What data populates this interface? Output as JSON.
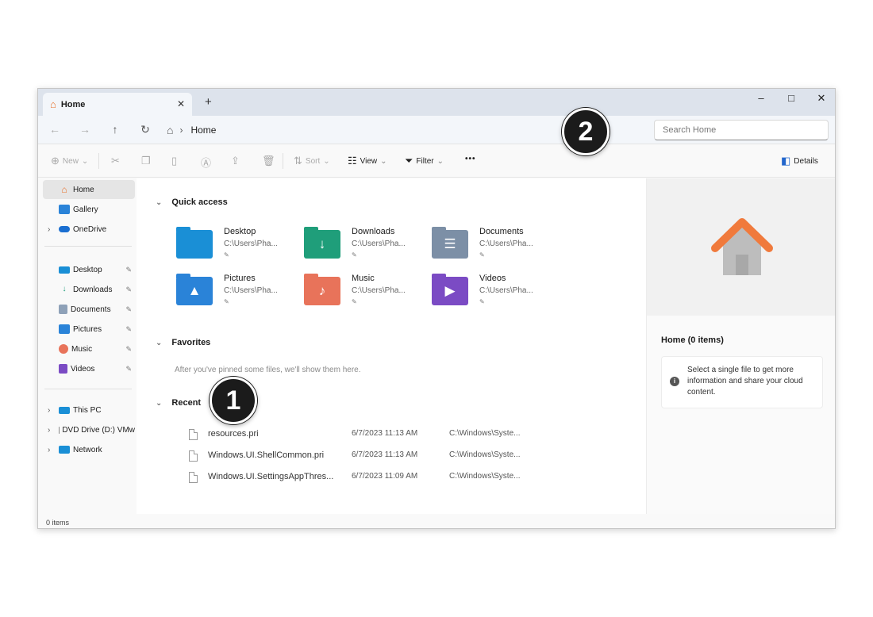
{
  "window": {
    "tab_title": "Home",
    "tab_close": "✕",
    "new_tab": "+",
    "minimize": "–",
    "maximize": "□",
    "close": "✕"
  },
  "nav": {
    "back": "←",
    "forward": "→",
    "up": "↑",
    "refresh": "↻",
    "breadcrumb": "Home",
    "search_placeholder": "Search Home"
  },
  "toolbar": {
    "new_label": "New",
    "sort_label": "Sort",
    "view_label": "View",
    "filter_label": "Filter",
    "more_label": "•••",
    "details_label": "Details"
  },
  "sidebar": {
    "items": [
      {
        "label": "Home",
        "icon": "home-icon"
      },
      {
        "label": "Gallery",
        "icon": "gallery-icon"
      },
      {
        "label": "OneDrive",
        "icon": "onedrive-icon"
      },
      {
        "label": "Desktop",
        "icon": "desktop-icon"
      },
      {
        "label": "Downloads",
        "icon": "downloads-icon"
      },
      {
        "label": "Documents",
        "icon": "documents-icon"
      },
      {
        "label": "Pictures",
        "icon": "pictures-icon"
      },
      {
        "label": "Music",
        "icon": "music-icon"
      },
      {
        "label": "Videos",
        "icon": "videos-icon"
      },
      {
        "label": "This PC",
        "icon": "computer-icon"
      },
      {
        "label": "DVD Drive (D:) VMw",
        "icon": "dvd-icon"
      },
      {
        "label": "Network",
        "icon": "network-icon"
      }
    ]
  },
  "main": {
    "quick_access_title": "Quick access",
    "quick_access": [
      {
        "name": "Desktop",
        "path": "C:\\Users\\Pha...",
        "color": "#1a8fd6",
        "glyph": ""
      },
      {
        "name": "Downloads",
        "path": "C:\\Users\\Pha...",
        "color": "#1f9e7a",
        "glyph": "↓"
      },
      {
        "name": "Documents",
        "path": "C:\\Users\\Pha...",
        "color": "#7c8fa6",
        "glyph": "☰"
      },
      {
        "name": "Pictures",
        "path": "C:\\Users\\Pha...",
        "color": "#2a83d8",
        "glyph": "▲"
      },
      {
        "name": "Music",
        "path": "C:\\Users\\Pha...",
        "color": "#e8735a",
        "glyph": "♪"
      },
      {
        "name": "Videos",
        "path": "C:\\Users\\Pha...",
        "color": "#7b4bc4",
        "glyph": "▶"
      }
    ],
    "favorites_title": "Favorites",
    "favorites_empty": "After you've pinned some files, we'll show them here.",
    "recent_title": "Recent",
    "recent": [
      {
        "name": "resources.pri",
        "date": "6/7/2023 11:13 AM",
        "location": "C:\\Windows\\Syste..."
      },
      {
        "name": "Windows.UI.ShellCommon.pri",
        "date": "6/7/2023 11:13 AM",
        "location": "C:\\Windows\\Syste..."
      },
      {
        "name": "Windows.UI.SettingsAppThres...",
        "date": "6/7/2023 11:09 AM",
        "location": "C:\\Windows\\Syste..."
      }
    ]
  },
  "details": {
    "title": "Home (0 items)",
    "info": "Select a single file to get more information and share your cloud content.",
    "info_icon": "i"
  },
  "status": {
    "items": "0 items"
  },
  "callouts": {
    "one": "1",
    "two": "2"
  },
  "colors": {
    "titlebar": "#dde3ec",
    "house_roof": "#f07a3c",
    "house_body": "#b9b9b9"
  }
}
